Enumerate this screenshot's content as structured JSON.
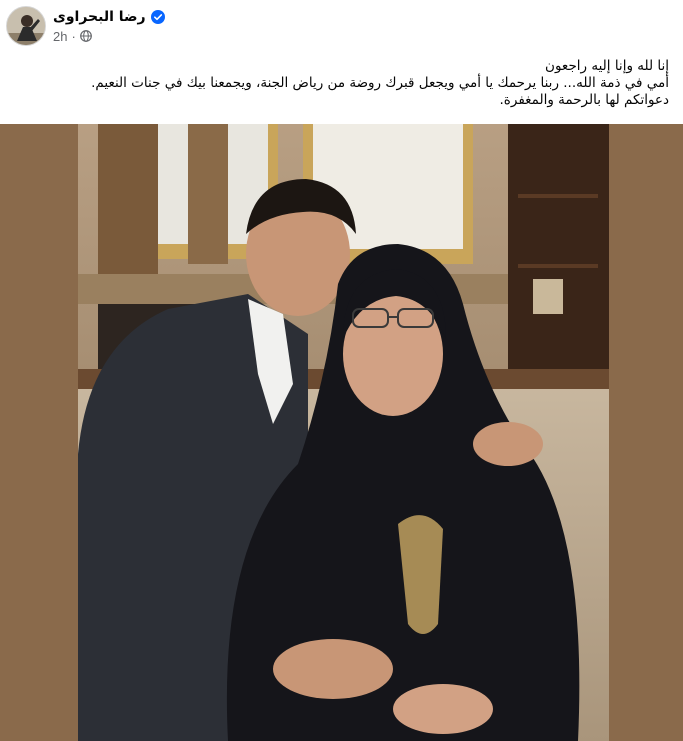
{
  "post": {
    "author_name": "رضا البحراوى",
    "timestamp": "2h",
    "separator": "·",
    "icons": {
      "avatar": "profile-photo",
      "verified": "verified-badge-icon",
      "audience": "globe-icon"
    },
    "text_lines": [
      "إنا لله وإنا إليه راجعون",
      "أمي في ذمة الله... ربنا يرحمك يا أمي ويجعل قبرك روضة من رياض الجنة، ويجمعنا بيك في جنات النعيم.",
      "دعواتكم لها بالرحمة والمغفرة."
    ]
  },
  "colors": {
    "accent_blue": "#0866ff",
    "meta_gray": "#65676b",
    "photo_border": "#8a6a4b"
  }
}
